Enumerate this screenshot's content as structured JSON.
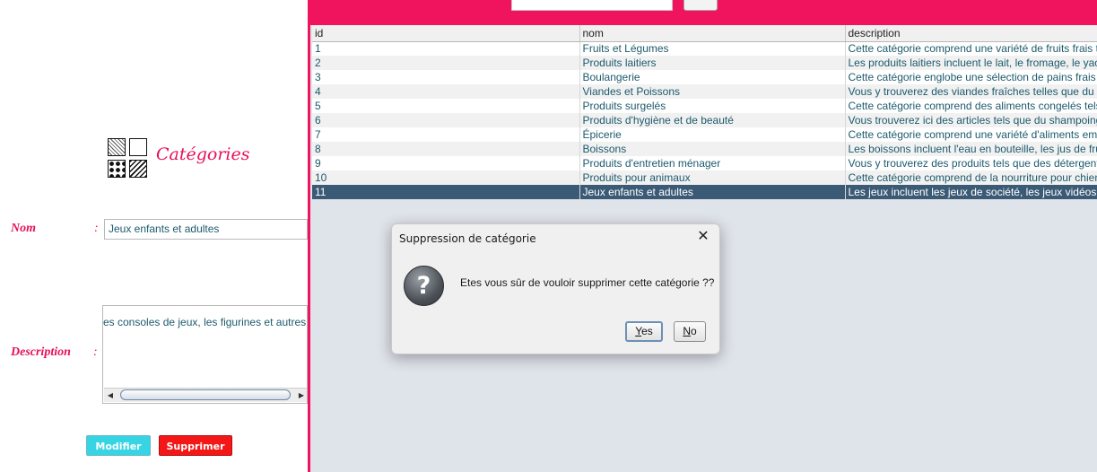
{
  "form": {
    "title": "Catégories",
    "nom_label": "Nom",
    "nom_colon": ":",
    "nom_value": "Jeux enfants et adultes",
    "description_label": "Description",
    "description_colon": ":",
    "description_visible_text": "es consoles de jeux, les figurines et autres.",
    "modifier_label": "Modifier",
    "supprimer_label": "Supprimer",
    "icons": [
      "categories-grid-icon",
      "scroll-left-arrow-icon",
      "scroll-right-arrow-icon"
    ]
  },
  "table": {
    "columns": [
      "id",
      "nom",
      "description"
    ],
    "selected_row_id": "11",
    "rows": [
      {
        "id": "1",
        "nom": "Fruits et Légumes",
        "description": "Cette catégorie comprend une variété de fruits frais te"
      },
      {
        "id": "2",
        "nom": "Produits laitiers",
        "description": "Les produits laitiers incluent le lait, le fromage, le yaou"
      },
      {
        "id": "3",
        "nom": "Boulangerie",
        "description": "Cette catégorie englobe une sélection de pains frais t"
      },
      {
        "id": "4",
        "nom": "Viandes et Poissons",
        "description": "Vous y trouverez des viandes fraîches telles que du b"
      },
      {
        "id": "5",
        "nom": "Produits surgelés",
        "description": "Cette catégorie comprend des aliments congelés tels"
      },
      {
        "id": "6",
        "nom": "Produits d'hygiène et de beauté",
        "description": "Vous trouverez ici des articles tels que du shampoing"
      },
      {
        "id": "7",
        "nom": "Épicerie",
        "description": "Cette catégorie comprend une variété d'aliments emb"
      },
      {
        "id": "8",
        "nom": "Boissons",
        "description": "Les boissons incluent l'eau en bouteille, les jus de frui"
      },
      {
        "id": "9",
        "nom": "Produits d'entretien ménager",
        "description": "Vous y trouverez des produits tels que des détergents"
      },
      {
        "id": "10",
        "nom": "Produits pour animaux",
        "description": "Cette catégorie comprend de la nourriture pour chiens"
      },
      {
        "id": "11",
        "nom": "Jeux enfants et adultes",
        "description": "Les jeux incluent les jeux de société, les jeux vidéos, l"
      }
    ]
  },
  "dialog": {
    "title": "Suppression de catégorie",
    "close_glyph": "✕",
    "icon_glyph": "?",
    "message": "Etes vous sûr de vouloir supprimer cette catégorie ??",
    "yes_mnemonic": "Y",
    "yes_rest": "es",
    "no_mnemonic": "N",
    "no_rest": "o",
    "icons": [
      "question-icon",
      "close-icon"
    ]
  },
  "colors": {
    "accent_pink": "#f0145e",
    "label_pink": "#e8105a",
    "text_teal": "#1d5a6c",
    "selected_row": "#3a5a75",
    "modifier_button": "#37d4e3",
    "supprimer_button": "#f31717",
    "panel_background": "#dfe3ea"
  }
}
